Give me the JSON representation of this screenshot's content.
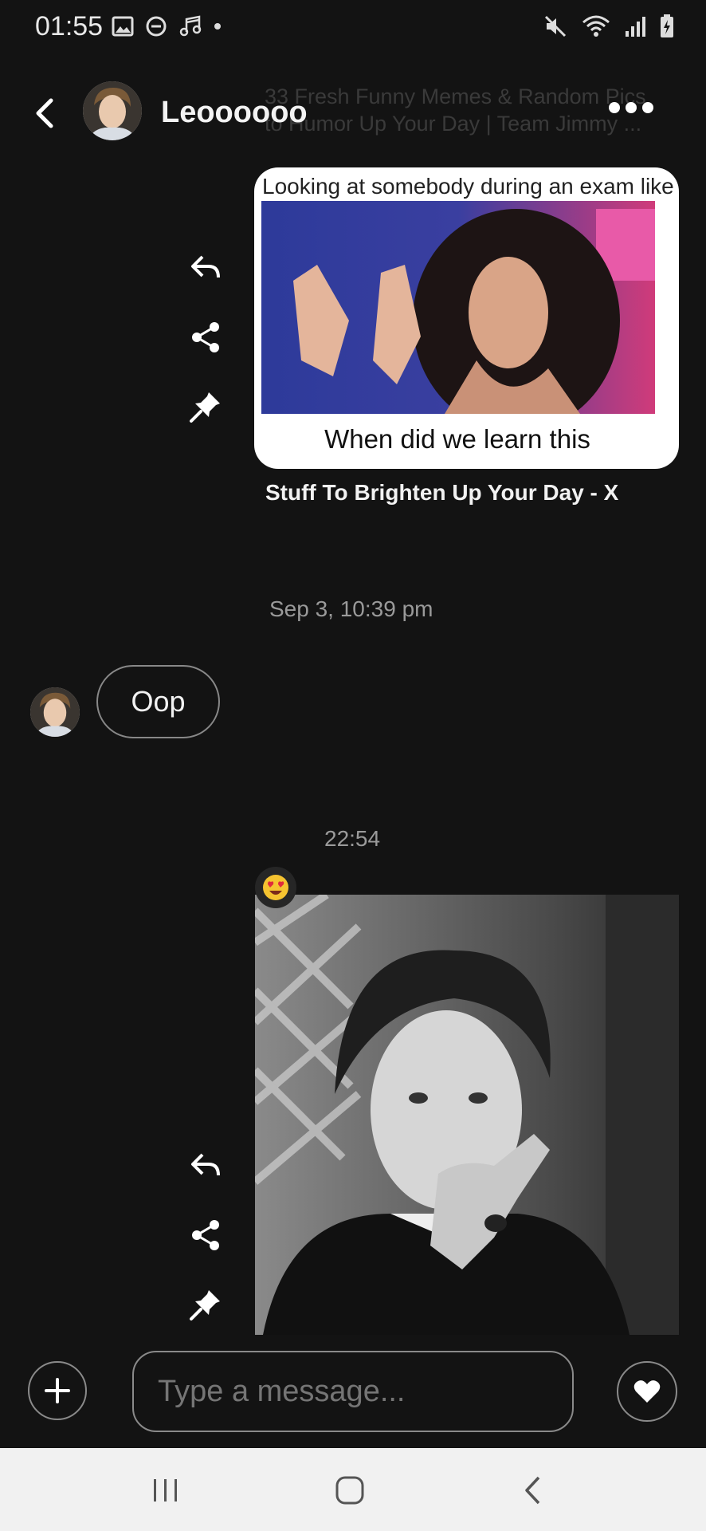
{
  "status_bar": {
    "time": "01:55",
    "left_icons": [
      "image-icon",
      "do-not-disturb-icon",
      "music-note-icon",
      "dot-icon"
    ],
    "right_icons": [
      "mute-icon",
      "wifi-icon",
      "signal-icon",
      "battery-charging-icon"
    ]
  },
  "header": {
    "contact_name": "Leoooooo",
    "ghost_link_text_line1": "33 Fresh Funny Memes & Random Pics",
    "ghost_link_text_line2": "to Humor Up Your Day | Team Jimmy ..."
  },
  "messages": [
    {
      "type": "meme-card",
      "top_text": "Looking at somebody during an exam like",
      "caption": "When did we learn this",
      "link_title": "Stuff To Brighten Up Your Day - X"
    },
    {
      "type": "timestamp",
      "text": "Sep 3, 10:39 pm"
    },
    {
      "type": "incoming-text",
      "text": "Oop"
    },
    {
      "type": "timestamp",
      "text": "22:54"
    },
    {
      "type": "photo",
      "reaction": "😍"
    }
  ],
  "composer": {
    "placeholder": "Type a message..."
  },
  "nav_bar": [
    "recent-apps-icon",
    "home-icon",
    "back-icon"
  ],
  "colors": {
    "background": "#131313",
    "nav_background": "#f1f1f1"
  }
}
